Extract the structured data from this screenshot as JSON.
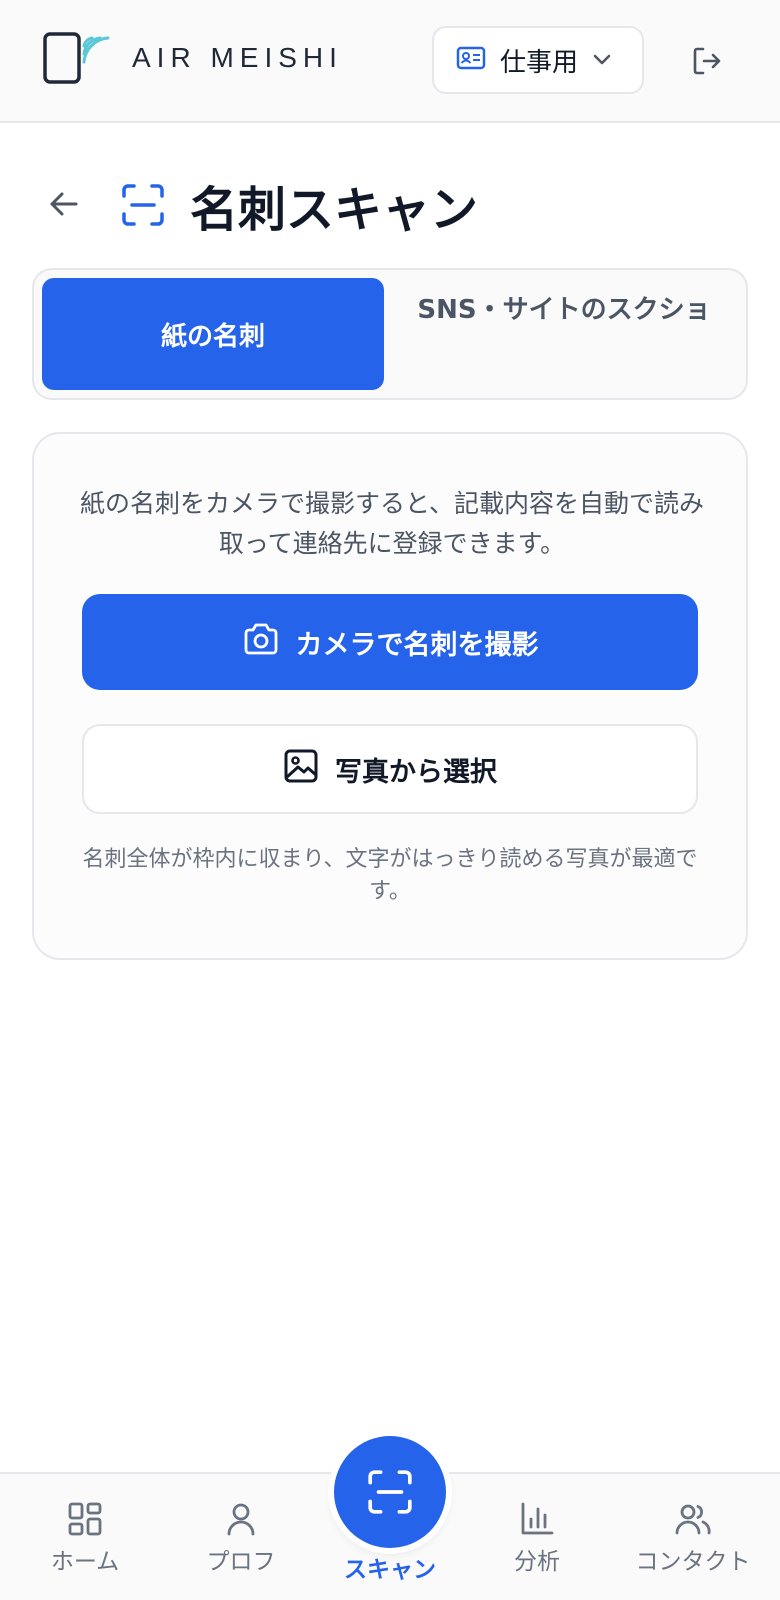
{
  "header": {
    "brand": "AIR MEISHI",
    "profile_select": {
      "selected": "仕事用"
    }
  },
  "page": {
    "title": "名刺スキャン"
  },
  "tabs": [
    {
      "label": "紙の名刺",
      "active": true
    },
    {
      "label": "SNS・サイトのスクショ",
      "active": false
    }
  ],
  "card": {
    "description": "紙の名刺をカメラで撮影すると、記載内容を自動で読み取って連絡先に登録できます。",
    "camera_button": "カメラで名刺を撮影",
    "photo_button": "写真から選択",
    "hint": "名刺全体が枠内に収まり、文字がはっきり読める写真が最適です。"
  },
  "bottom_nav": {
    "items": [
      {
        "label": "ホーム",
        "icon": "grid-icon"
      },
      {
        "label": "プロフ",
        "icon": "user-icon"
      },
      {
        "label": "スキャン",
        "icon": "scan-icon",
        "active": true
      },
      {
        "label": "分析",
        "icon": "bar-chart-icon"
      },
      {
        "label": "コンタクト",
        "icon": "users-icon"
      }
    ]
  },
  "colors": {
    "accent": "#2563eb",
    "logo_wave": "#5bc8d8"
  }
}
